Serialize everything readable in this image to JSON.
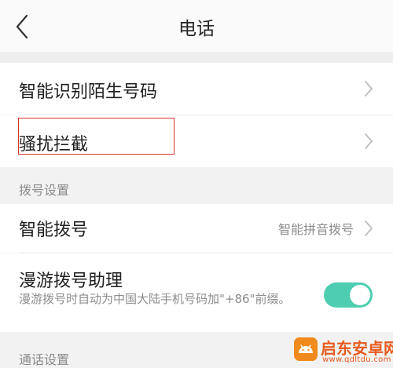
{
  "header": {
    "title": "电话"
  },
  "rows": {
    "smart_identify": {
      "label": "智能识别陌生号码"
    },
    "harassment_block": {
      "label": "骚扰拦截"
    }
  },
  "sections": {
    "dial": {
      "label": "拨号设置",
      "smart_dial": {
        "label": "智能拨号",
        "value": "智能拼音拨号"
      },
      "roaming": {
        "label": "漫游拨号助理",
        "description": "漫游拨号时自动为中国大陆手机号码加\"+86\"前缀。",
        "enabled": true
      }
    },
    "call": {
      "label": "通话设置"
    }
  },
  "watermark": {
    "name": "启东安卓网",
    "url": "www.qdltdu.com"
  },
  "colors": {
    "toggle_on": "#4fcdb1",
    "highlight_border": "#d93025",
    "watermark": "#e65a1e"
  }
}
